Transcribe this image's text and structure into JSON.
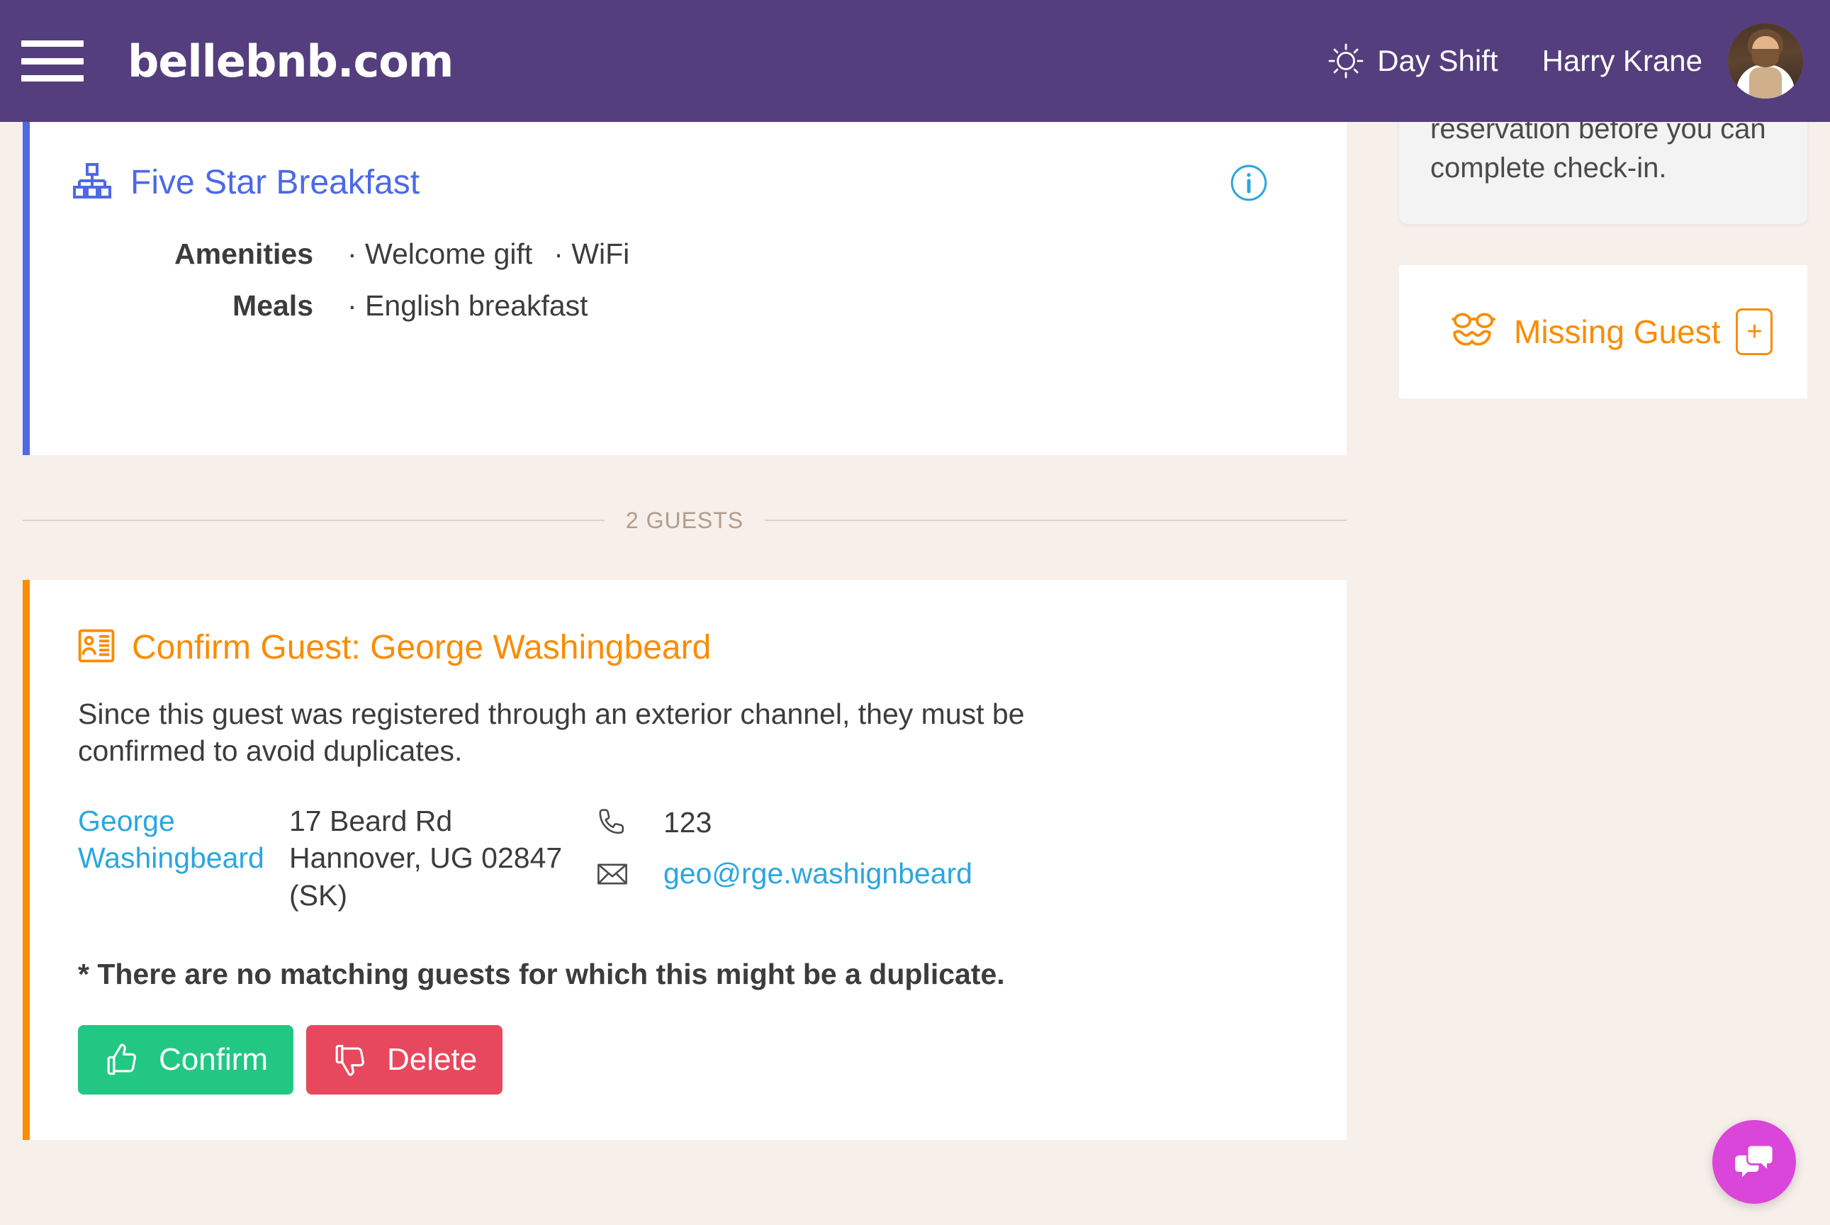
{
  "header": {
    "menu_icon": "hamburger-icon",
    "brand": "bellebnb.com",
    "shift_icon": "sun-icon",
    "shift_label": "Day Shift",
    "user_name": "Harry Krane",
    "avatar_icon": "user-avatar",
    "background_color": "#543e7d"
  },
  "rate_plan": {
    "icon": "sitemap-icon",
    "title": "Five Star Breakfast",
    "accent_color": "#4d69e8",
    "info_icon": "info-circle-icon",
    "rows": [
      {
        "label": "Amenities",
        "values": [
          "Welcome gift",
          "WiFi"
        ]
      },
      {
        "label": "Meals",
        "values": [
          "English breakfast"
        ]
      }
    ]
  },
  "divider": {
    "guests_count_label": "2 GUESTS"
  },
  "confirm_guest": {
    "icon": "id-card-icon",
    "title": "Confirm Guest: George Washingbeard",
    "accent_color": "#fa8c00",
    "description": "Since this guest was registered through an exterior channel, they must be confirmed to avoid duplicates.",
    "contact": {
      "name": "George Washingbeard",
      "address_line1": "17 Beard Rd",
      "address_line2": "Hannover, UG 02847 (SK)",
      "phone_icon": "phone-icon",
      "phone": "123",
      "email_icon": "envelope-icon",
      "email": "geo@rge.washignbeard"
    },
    "duplicate_note": "* There are no matching guests for which this might be a duplicate.",
    "buttons": {
      "confirm_icon": "thumbs-up-icon",
      "confirm_label": "Confirm",
      "confirm_color": "#22c784",
      "delete_icon": "thumbs-down-icon",
      "delete_label": "Delete",
      "delete_color": "#e8485e"
    }
  },
  "sidebar": {
    "notice_text": "that must be added to this reservation before you can complete check-in.",
    "missing_guest": {
      "icon": "disguise-glasses-mustache-icon",
      "label": "Missing Guest",
      "add_label": "+",
      "accent_color": "#fa8c00"
    }
  },
  "chat": {
    "icon": "chat-bubbles-icon",
    "color": "#d946d9"
  }
}
